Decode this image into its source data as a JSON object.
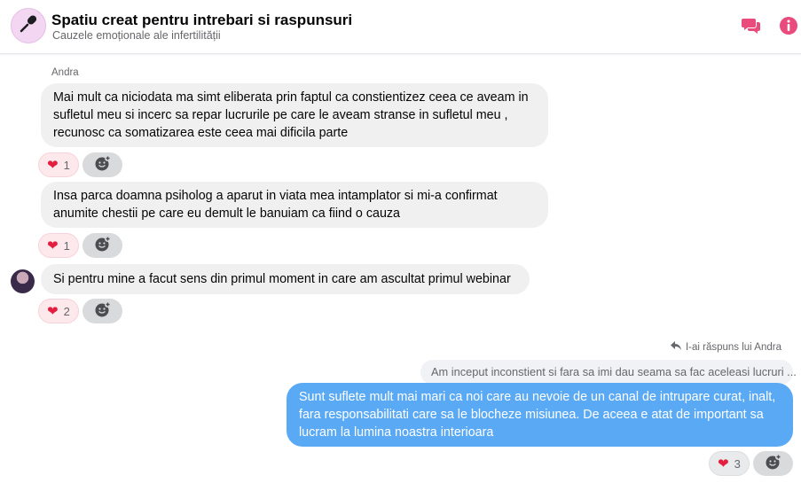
{
  "header": {
    "title": "Spatiu creat pentru intrebari si raspunsuri",
    "subtitle": "Cauzele emoționale ale infertilității",
    "group_icon": "microphone-icon",
    "icons": [
      "chat-bubbles-icon",
      "info-icon"
    ],
    "accent_color": "#e94b7d"
  },
  "messages": [
    {
      "sender": "Andra",
      "text_lines": [
        "Mai mult ca niciodata ma simt eliberata prin faptul ca constientizez ceea ce aveam in",
        "sufletul meu si incerc sa repar lucrurile pe care le aveam stranse in sufletul meu ,",
        "recunosc ca somatizarea este ceea mai dificila parte"
      ],
      "reaction": {
        "icon": "heart-icon",
        "count": "1"
      }
    },
    {
      "text_lines": [
        "Insa parca doamna psiholog a aparut in viata mea intamplator si mi-a confirmat",
        "anumite chestii pe care eu demult le banuiam ca fiind o cauza"
      ],
      "reaction": {
        "icon": "heart-icon",
        "count": "1"
      }
    },
    {
      "text_lines": [
        "Si pentru mine a facut sens din primul moment in care am ascultat primul webinar"
      ],
      "reaction": {
        "icon": "heart-icon",
        "count": "2"
      }
    }
  ],
  "my_reply": {
    "replied_to_label": "I-ai răspuns lui Andra",
    "quoted_text": "Am inceput inconstient si fara sa imi dau seama sa fac aceleasi lucruri ...",
    "text_lines": [
      "Sunt suflete mult mai mari ca noi care au nevoie de un canal de intrupare curat, inalt,",
      "fara responsabilitati care sa le blocheze misiunea. De aceea e atat de important sa",
      "lucram la lumina noastra interioara"
    ],
    "bubble_color": "#5aa9f5",
    "reaction": {
      "icon": "heart-icon",
      "count": "3"
    }
  },
  "add_reaction_icon": "add-reaction-icon"
}
